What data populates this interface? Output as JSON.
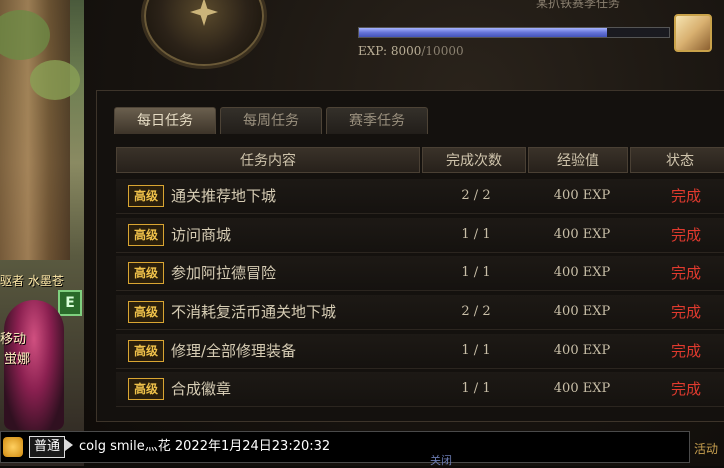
{
  "left_scene": {
    "character_name": "驱者 水墨苍",
    "badge": "E",
    "char_text_1": "移动",
    "char_text_2": "蛍娜"
  },
  "header": {
    "title": "某扒铁赛季任务",
    "exp_label": "EXP:",
    "exp_current": "8000",
    "exp_separator": "/",
    "exp_max": "10000",
    "exp_fraction": 0.8
  },
  "tabs": [
    {
      "label": "每日任务",
      "active": true
    },
    {
      "label": "每周任务",
      "active": false
    },
    {
      "label": "赛季任务",
      "active": false
    }
  ],
  "table": {
    "headers": [
      "任务内容",
      "完成次数",
      "经验值",
      "状态"
    ],
    "rows": [
      {
        "badge": "高级",
        "task": "通关推荐地下城",
        "count": "2 / 2",
        "exp": "400 EXP",
        "status": "完成"
      },
      {
        "badge": "高级",
        "task": "访问商城",
        "count": "1 / 1",
        "exp": "400 EXP",
        "status": "完成"
      },
      {
        "badge": "高级",
        "task": "参加阿拉德冒险",
        "count": "1 / 1",
        "exp": "400 EXP",
        "status": "完成"
      },
      {
        "badge": "高级",
        "task": "不消耗复活币通关地下城",
        "count": "2 / 2",
        "exp": "400 EXP",
        "status": "完成"
      },
      {
        "badge": "高级",
        "task": "修理/全部修理装备",
        "count": "1 / 1",
        "exp": "400 EXP",
        "status": "完成"
      },
      {
        "badge": "高级",
        "task": "合成徽章",
        "count": "1 / 1",
        "exp": "400 EXP",
        "status": "完成"
      }
    ]
  },
  "chat": {
    "channel": "普通",
    "message": "colg smile灬花 2022年1月24日23:20:32"
  },
  "footer": {
    "right_text": "活动",
    "mid_text": "关闭"
  },
  "colors": {
    "status_done": "#e03a2e",
    "badge_gold": "#f0c24a",
    "exp_bar": "#6574d8"
  }
}
